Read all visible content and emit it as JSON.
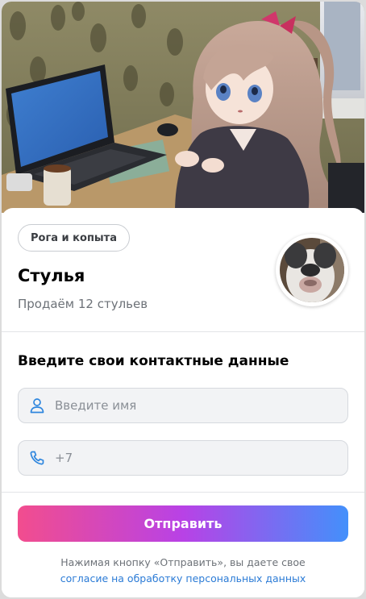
{
  "colors": {
    "accent_gradient": [
      "#f24d8e",
      "#b842e6",
      "#4390fb"
    ],
    "link": "#2b7bd6",
    "icon": "#2e86de"
  },
  "hero": {
    "image": "anime-girl-at-laptop-photo"
  },
  "community": {
    "chip_label": "Рога и копыта",
    "title": "Стулья",
    "subtitle": "Продаём 12 стульев",
    "avatar": "dog-face-photo"
  },
  "form": {
    "heading": "Введите свои контактные данные",
    "name_field": {
      "icon": "user-icon",
      "placeholder": "Введите имя",
      "value": ""
    },
    "phone_field": {
      "icon": "phone-icon",
      "placeholder": "+7",
      "value": ""
    },
    "submit_label": "Отправить"
  },
  "consent": {
    "text": "Нажимая кнопку «Отправить», вы даете свое",
    "link": "согласие на обработку персональных данных"
  }
}
